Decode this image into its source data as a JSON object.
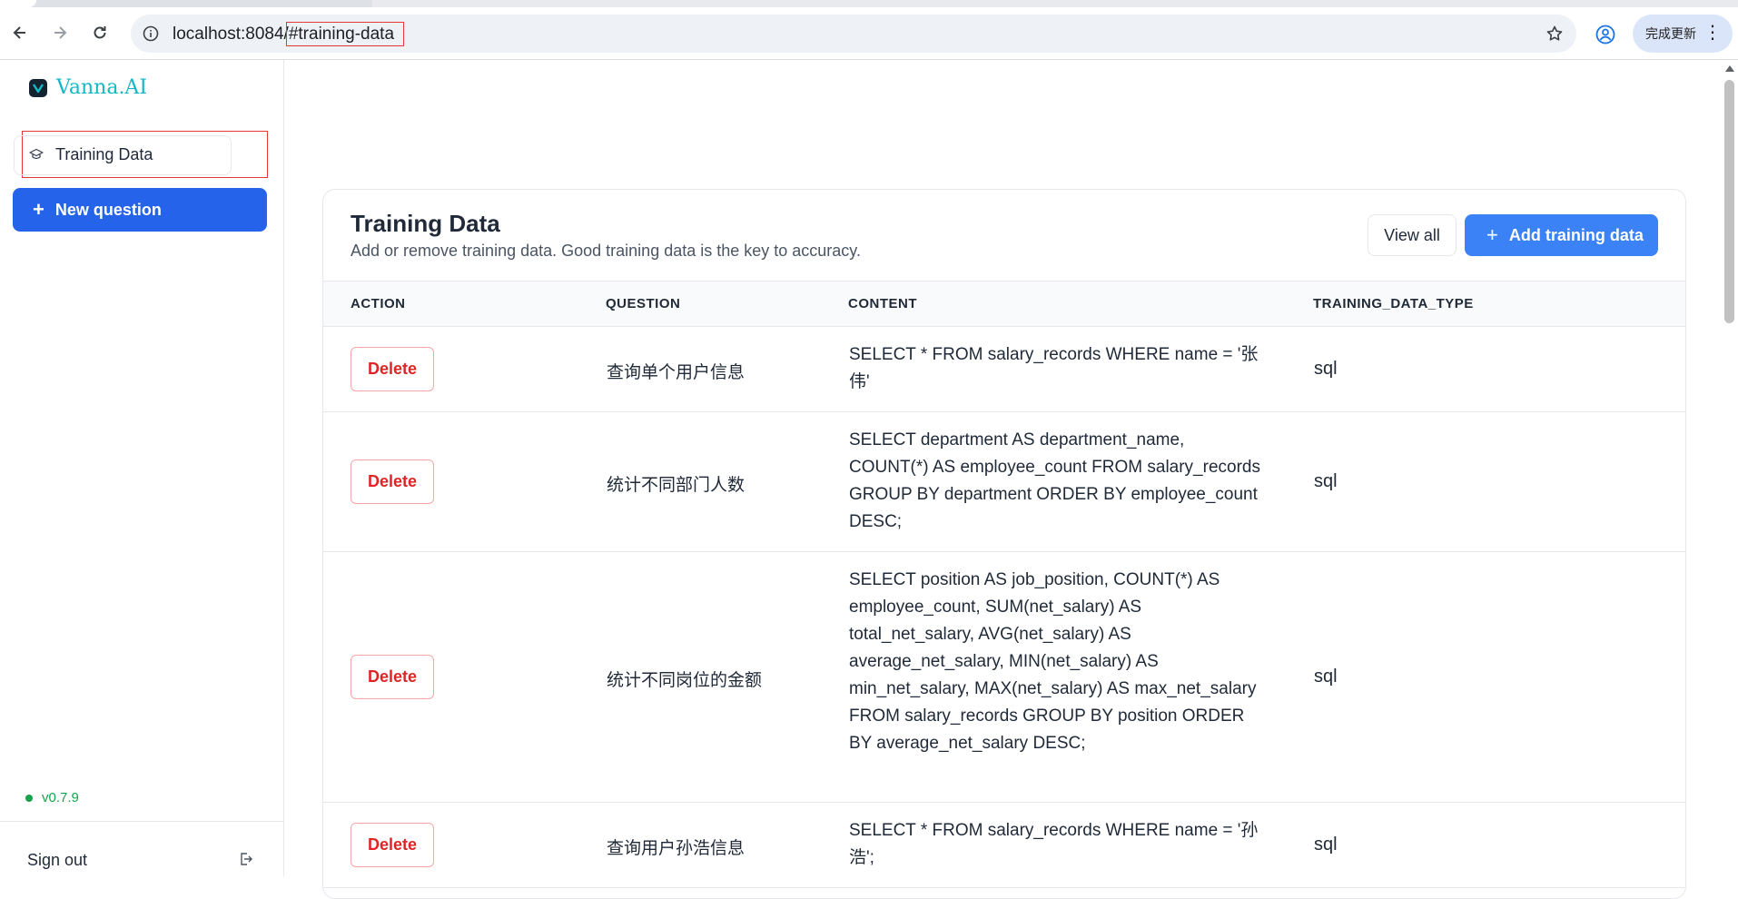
{
  "browser": {
    "url_host": "localhost:8084/",
    "url_hash": "#training-data",
    "update_label": "完成更新"
  },
  "sidebar": {
    "brand": "Vanna.AI",
    "nav_items": [
      {
        "label": "Training Data"
      }
    ],
    "new_question_label": "New question",
    "version": "v0.7.9",
    "signout_label": "Sign out"
  },
  "main": {
    "title": "Training Data",
    "subtitle": "Add or remove training data. Good training data is the key to accuracy.",
    "view_all_label": "View all",
    "add_label": "Add training data",
    "columns": [
      "ACTION",
      "QUESTION",
      "CONTENT",
      "TRAINING_DATA_TYPE"
    ],
    "rows": [
      {
        "action": "Delete",
        "question": "查询单个用户信息",
        "content": "SELECT * FROM salary_records WHERE name = '张伟'",
        "type": "sql"
      },
      {
        "action": "Delete",
        "question": "统计不同部门人数",
        "content": "SELECT department AS department_name, COUNT(*) AS employee_count FROM salary_records GROUP BY department ORDER BY employee_count DESC;",
        "type": "sql"
      },
      {
        "action": "Delete",
        "question": "统计不同岗位的金额",
        "content": "SELECT position AS job_position, COUNT(*) AS employee_count, SUM(net_salary) AS total_net_salary, AVG(net_salary) AS average_net_salary, MIN(net_salary) AS min_net_salary, MAX(net_salary) AS max_net_salary FROM salary_records GROUP BY position ORDER BY average_net_salary DESC;",
        "type": "sql"
      },
      {
        "action": "Delete",
        "question": "查询用户孙浩信息",
        "content": "SELECT * FROM salary_records WHERE name = '孙浩';",
        "type": "sql"
      }
    ]
  },
  "colors": {
    "primary": "#2563eb",
    "accent": "#3b82f6",
    "danger": "#dc2626",
    "success": "#16a34a",
    "brand": "#14b8c4"
  }
}
